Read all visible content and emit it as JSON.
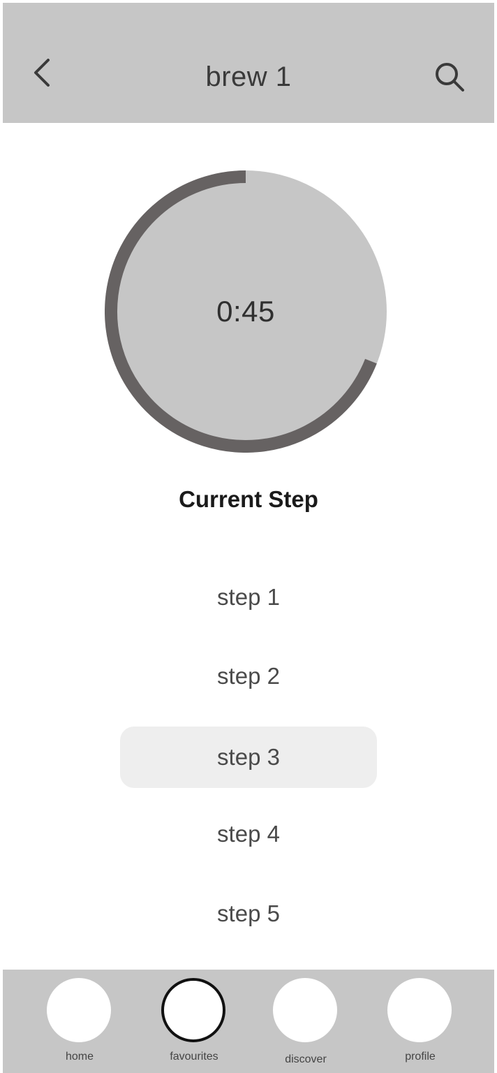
{
  "header": {
    "title": "brew 1",
    "back_icon": "chevron-left-icon",
    "search_icon": "search-icon"
  },
  "timer": {
    "time": "0:45",
    "progress_fraction": 0.69,
    "track_color": "#c6c6c6",
    "progress_color": "#666262"
  },
  "current_step_label": "Current Step",
  "steps": [
    {
      "label": "step 1",
      "active": false
    },
    {
      "label": "step 2",
      "active": false
    },
    {
      "label": "step 3",
      "active": true
    },
    {
      "label": "step 4",
      "active": false
    },
    {
      "label": "step 5",
      "active": false
    }
  ],
  "nav": {
    "items": [
      {
        "label": "home",
        "selected": false
      },
      {
        "label": "favourites",
        "selected": true
      },
      {
        "label": "discover",
        "selected": false
      },
      {
        "label": "profile",
        "selected": false
      }
    ]
  },
  "colors": {
    "bar_background": "#c6c6c6",
    "active_step_background": "#eeeeee"
  }
}
